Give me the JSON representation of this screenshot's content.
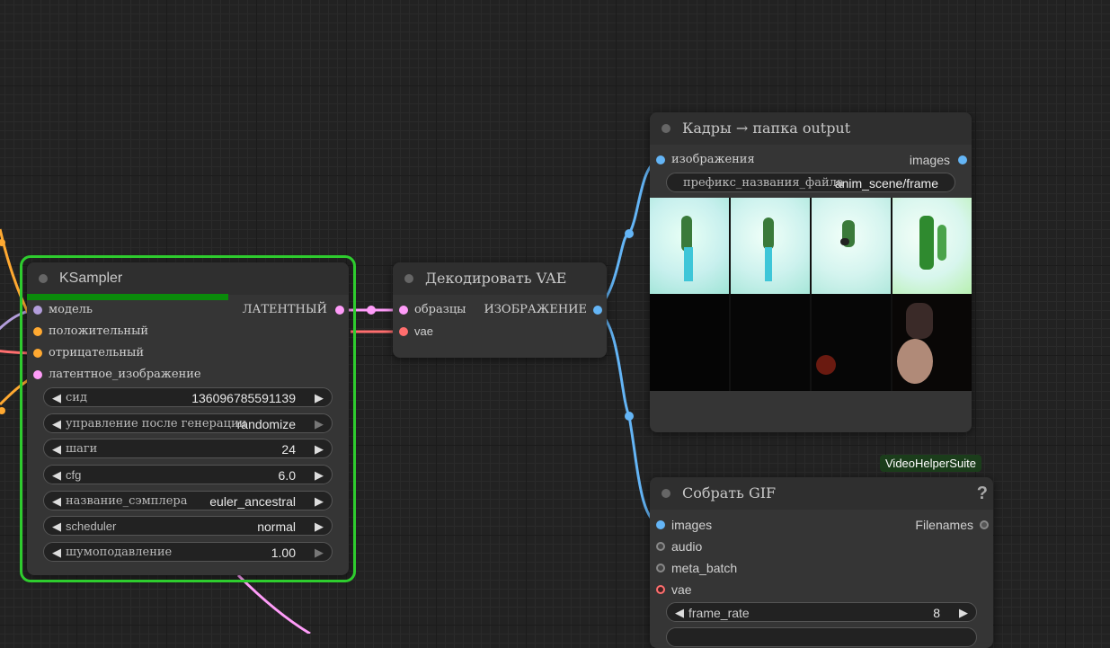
{
  "ksampler": {
    "title": "KSampler",
    "inputs": [
      "модель",
      "положительный",
      "отрицательный",
      "латентное_изображение"
    ],
    "output": "ЛАТЕНТНЫЙ",
    "progress": 0.66,
    "widgets": [
      {
        "label": "сид",
        "value": "136096785591139"
      },
      {
        "label": "управление после генерации",
        "value": "randomize"
      },
      {
        "label": "шаги",
        "value": "24"
      },
      {
        "label": "cfg",
        "value": "6.0"
      },
      {
        "label": "название_сэмплера",
        "value": "euler_ancestral"
      },
      {
        "label": "scheduler",
        "value": "normal"
      },
      {
        "label": "шумоподавление",
        "value": "1.00"
      }
    ]
  },
  "vae_decode": {
    "title": "Декодировать VAE",
    "inputs": [
      "образцы",
      "vae"
    ],
    "output": "ИЗОБРАЖЕНИЕ"
  },
  "frames_node": {
    "title": "Кадры → папка output",
    "input": "изображения",
    "output": "images",
    "prefix_label": "префикс_названия_файла",
    "prefix_value": "anim_scene/frame"
  },
  "gif_node": {
    "badge": "VideoHelperSuite",
    "title": "Собрать GIF",
    "help": "?",
    "inputs": [
      "images",
      "audio",
      "meta_batch",
      "vae"
    ],
    "output": "Filenames",
    "widget_label": "frame_rate",
    "widget_value": "8"
  },
  "colors": {
    "model": "#b39ddb",
    "conditioning": "#ffa931",
    "latent": "#ff9cf9",
    "vae": "#ff6e6e",
    "image": "#64b5f6",
    "selected_outline": "#2ecc2e",
    "progress": "#0a8a0a"
  }
}
